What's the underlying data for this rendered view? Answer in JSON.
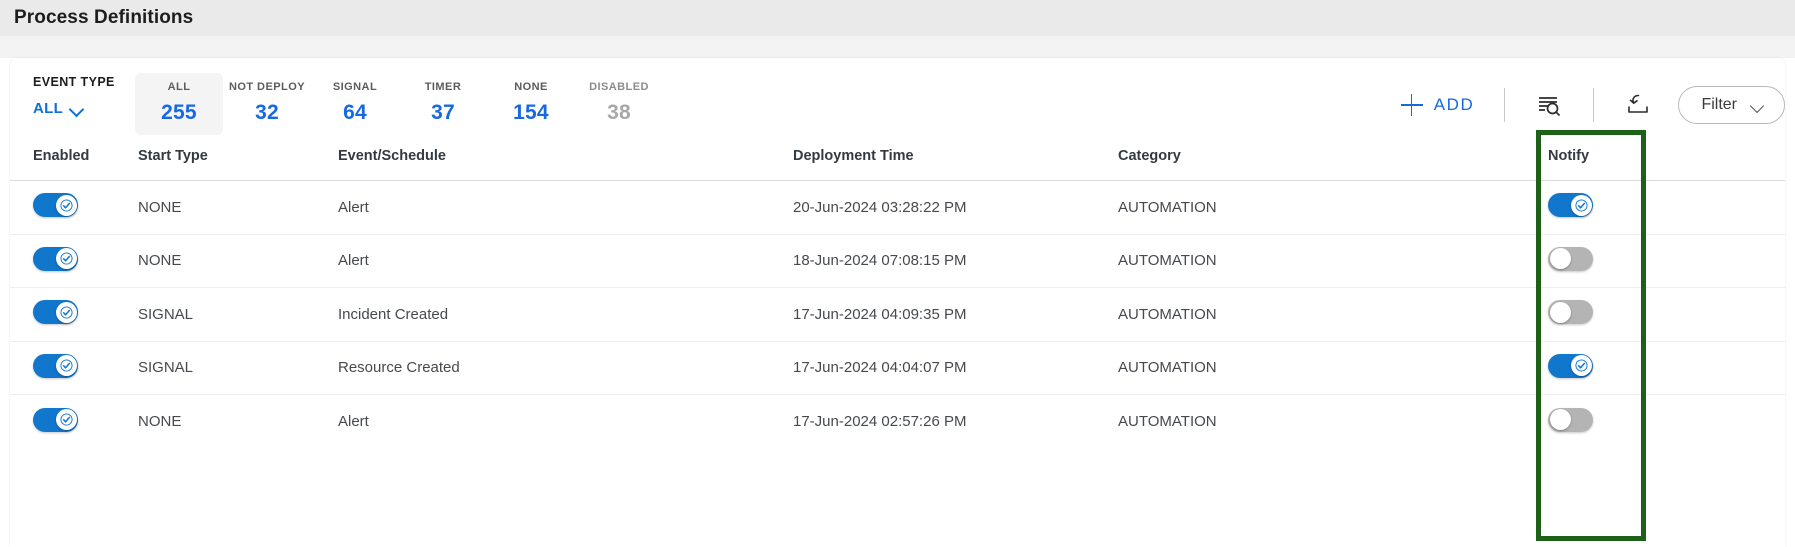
{
  "page": {
    "title": "Process Definitions"
  },
  "toolbar": {
    "event_type_label": "EVENT TYPE",
    "event_type_value": "ALL",
    "event_type_chevron_icon": "chevron-down-icon",
    "add_label": "ADD",
    "add_icon": "plus-icon",
    "search_list_icon": "search-list-icon",
    "export_icon": "export-download-icon",
    "filter_label": "Filter",
    "filter_chevron_icon": "chevron-down-icon",
    "stats": [
      {
        "label": "ALL",
        "value": "255",
        "active": true,
        "disabled": false
      },
      {
        "label": "NOT DEPLOY",
        "value": "32",
        "active": false,
        "disabled": false
      },
      {
        "label": "SIGNAL",
        "value": "64",
        "active": false,
        "disabled": false
      },
      {
        "label": "TIMER",
        "value": "37",
        "active": false,
        "disabled": false
      },
      {
        "label": "NONE",
        "value": "154",
        "active": false,
        "disabled": false
      },
      {
        "label": "DISABLED",
        "value": "38",
        "active": false,
        "disabled": true
      }
    ]
  },
  "table": {
    "columns": [
      "Enabled",
      "Start Type",
      "Event/Schedule",
      "Deployment Time",
      "Category",
      "Notify"
    ],
    "rows": [
      {
        "enabled": true,
        "start_type": "NONE",
        "event_schedule": "Alert",
        "deployment_time": "20-Jun-2024 03:28:22 PM",
        "category": "AUTOMATION",
        "notify": true
      },
      {
        "enabled": true,
        "start_type": "NONE",
        "event_schedule": "Alert",
        "deployment_time": "18-Jun-2024 07:08:15 PM",
        "category": "AUTOMATION",
        "notify": false
      },
      {
        "enabled": true,
        "start_type": "SIGNAL",
        "event_schedule": "Incident Created",
        "deployment_time": "17-Jun-2024 04:09:35 PM",
        "category": "AUTOMATION",
        "notify": false
      },
      {
        "enabled": true,
        "start_type": "SIGNAL",
        "event_schedule": "Resource Created",
        "deployment_time": "17-Jun-2024 04:04:07 PM",
        "category": "AUTOMATION",
        "notify": true
      },
      {
        "enabled": true,
        "start_type": "NONE",
        "event_schedule": "Alert",
        "deployment_time": "17-Jun-2024 02:57:26 PM",
        "category": "AUTOMATION",
        "notify": false
      }
    ]
  },
  "annotation": {
    "highlight_color": "#1d6017",
    "highlight_target": "Notify"
  }
}
